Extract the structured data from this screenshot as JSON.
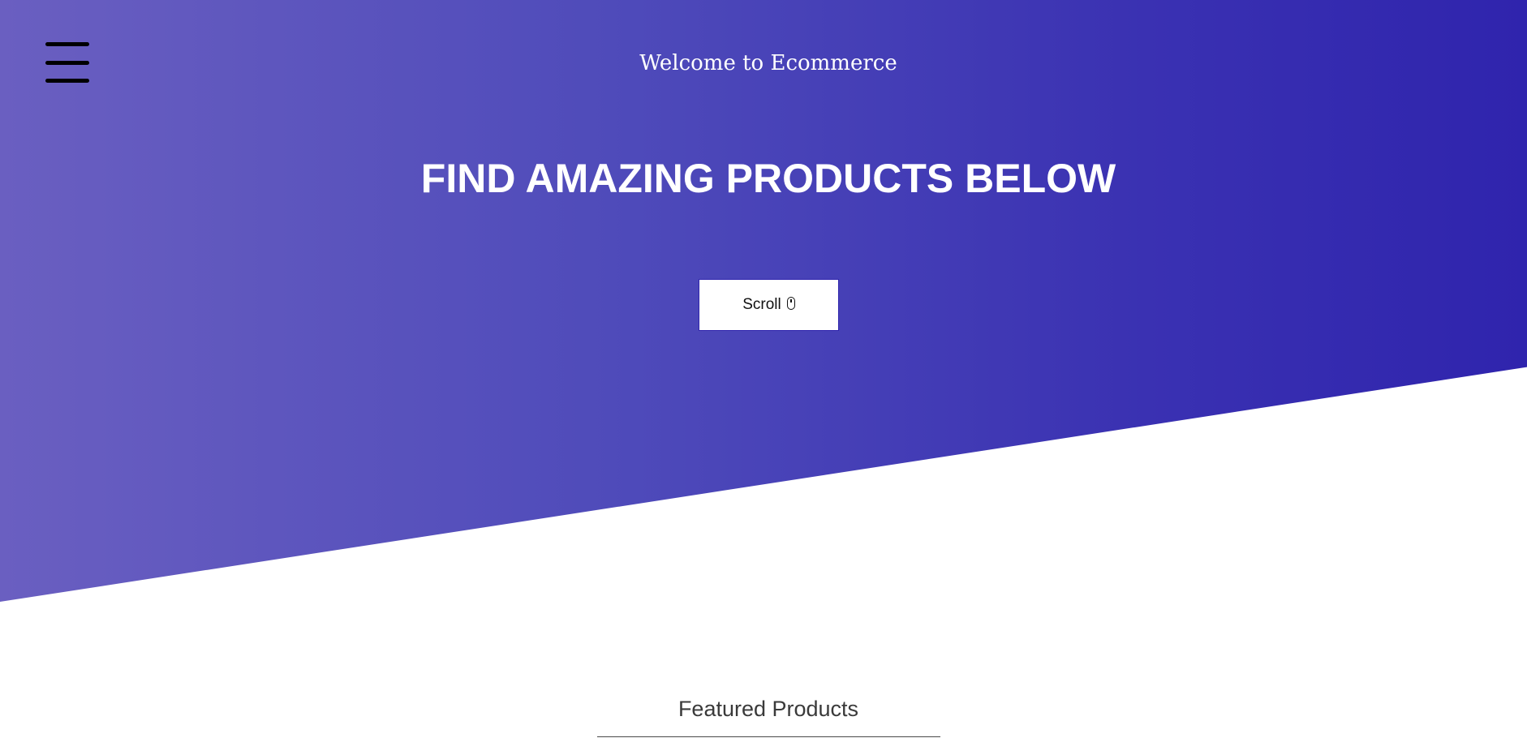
{
  "header": {
    "menu_icon": "hamburger-menu-icon",
    "welcome_text": "Welcome to Ecommerce"
  },
  "hero": {
    "headline": "FIND AMAZING PRODUCTS BELOW",
    "scroll_button": {
      "label": "Scroll",
      "icon": "mouse-icon"
    },
    "gradient_colors": [
      "#6a5fc1",
      "#2f24ad"
    ]
  },
  "featured": {
    "title": "Featured Products"
  }
}
